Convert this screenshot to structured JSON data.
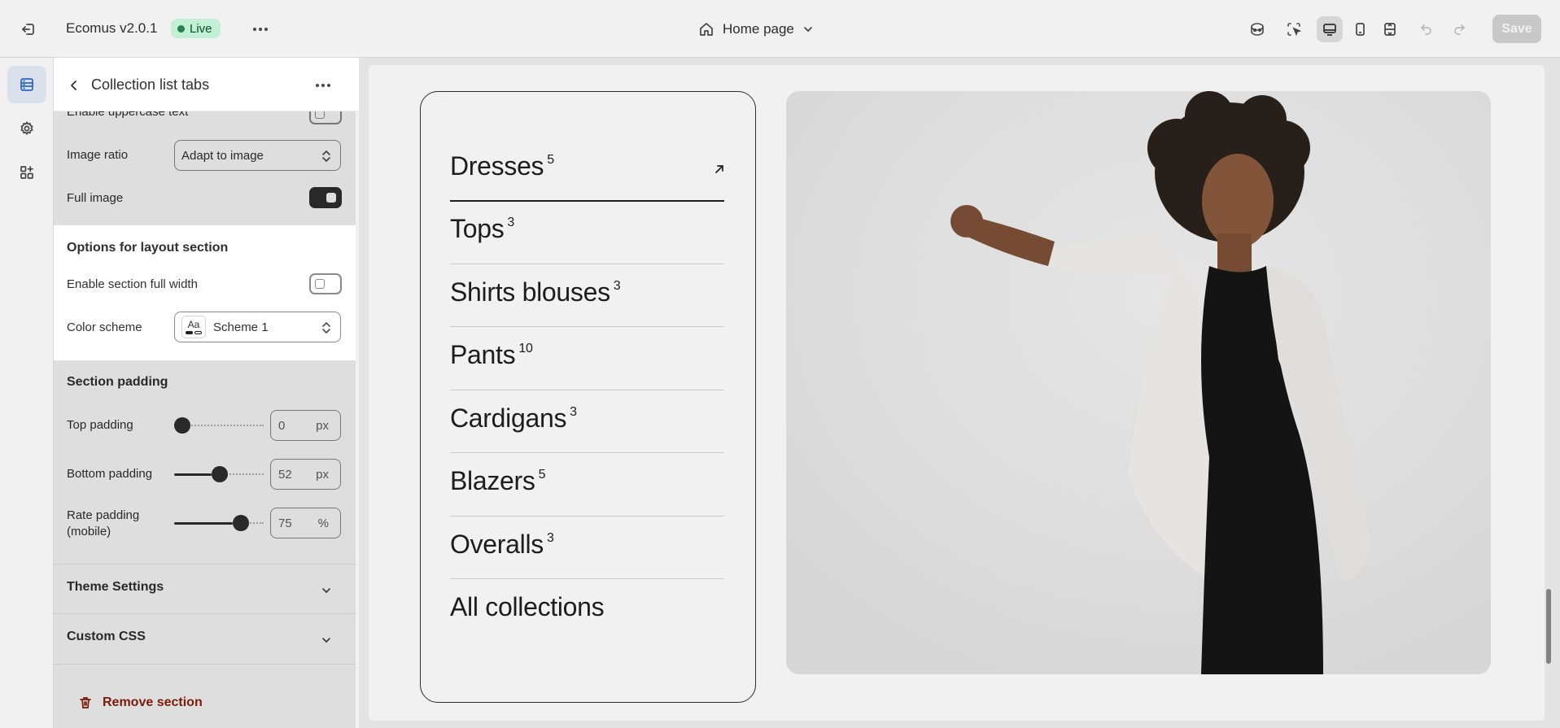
{
  "topbar": {
    "app_name": "Ecomus v2.0.1",
    "status": "Live",
    "page": "Home page",
    "save_label": "Save",
    "colors": {
      "live_bg": "#cdfee1",
      "live_text": "#0c5132",
      "save_bg": "#d4d4d4"
    }
  },
  "rail": {
    "items": [
      {
        "icon": "sections-icon",
        "active": true
      },
      {
        "icon": "gear-icon",
        "active": false
      },
      {
        "icon": "apps-icon",
        "active": false
      }
    ]
  },
  "panel": {
    "title": "Collection list tabs",
    "uppercase_label": "Enable uppercase text",
    "image_ratio": {
      "label": "Image ratio",
      "value": "Adapt to image"
    },
    "full_image": {
      "label": "Full image",
      "on": true
    },
    "layout_header": "Options for layout section",
    "full_width": {
      "label": "Enable section full width",
      "on": false
    },
    "color_scheme": {
      "label": "Color scheme",
      "swatch": "Aa",
      "value": "Scheme 1"
    },
    "padding_header": "Section padding",
    "top_padding": {
      "label": "Top padding",
      "value": "0",
      "unit": "px",
      "level": 0
    },
    "bottom_padding": {
      "label": "Bottom padding",
      "value": "52",
      "unit": "px",
      "level": 0.52
    },
    "rate_padding": {
      "label": "Rate padding (mobile)",
      "value": "75",
      "unit": "%",
      "level": 0.75
    },
    "theme_settings": "Theme Settings",
    "custom_css": "Custom CSS",
    "remove_label": "Remove section"
  },
  "preview": {
    "collections": [
      {
        "name": "Dresses",
        "count": "5"
      },
      {
        "name": "Tops",
        "count": "3"
      },
      {
        "name": "Shirts blouses",
        "count": "3"
      },
      {
        "name": "Pants",
        "count": "10"
      },
      {
        "name": "Cardigans",
        "count": "3"
      },
      {
        "name": "Blazers",
        "count": "5"
      },
      {
        "name": "Overalls",
        "count": "3"
      },
      {
        "name": "All collections",
        "count": ""
      }
    ]
  }
}
